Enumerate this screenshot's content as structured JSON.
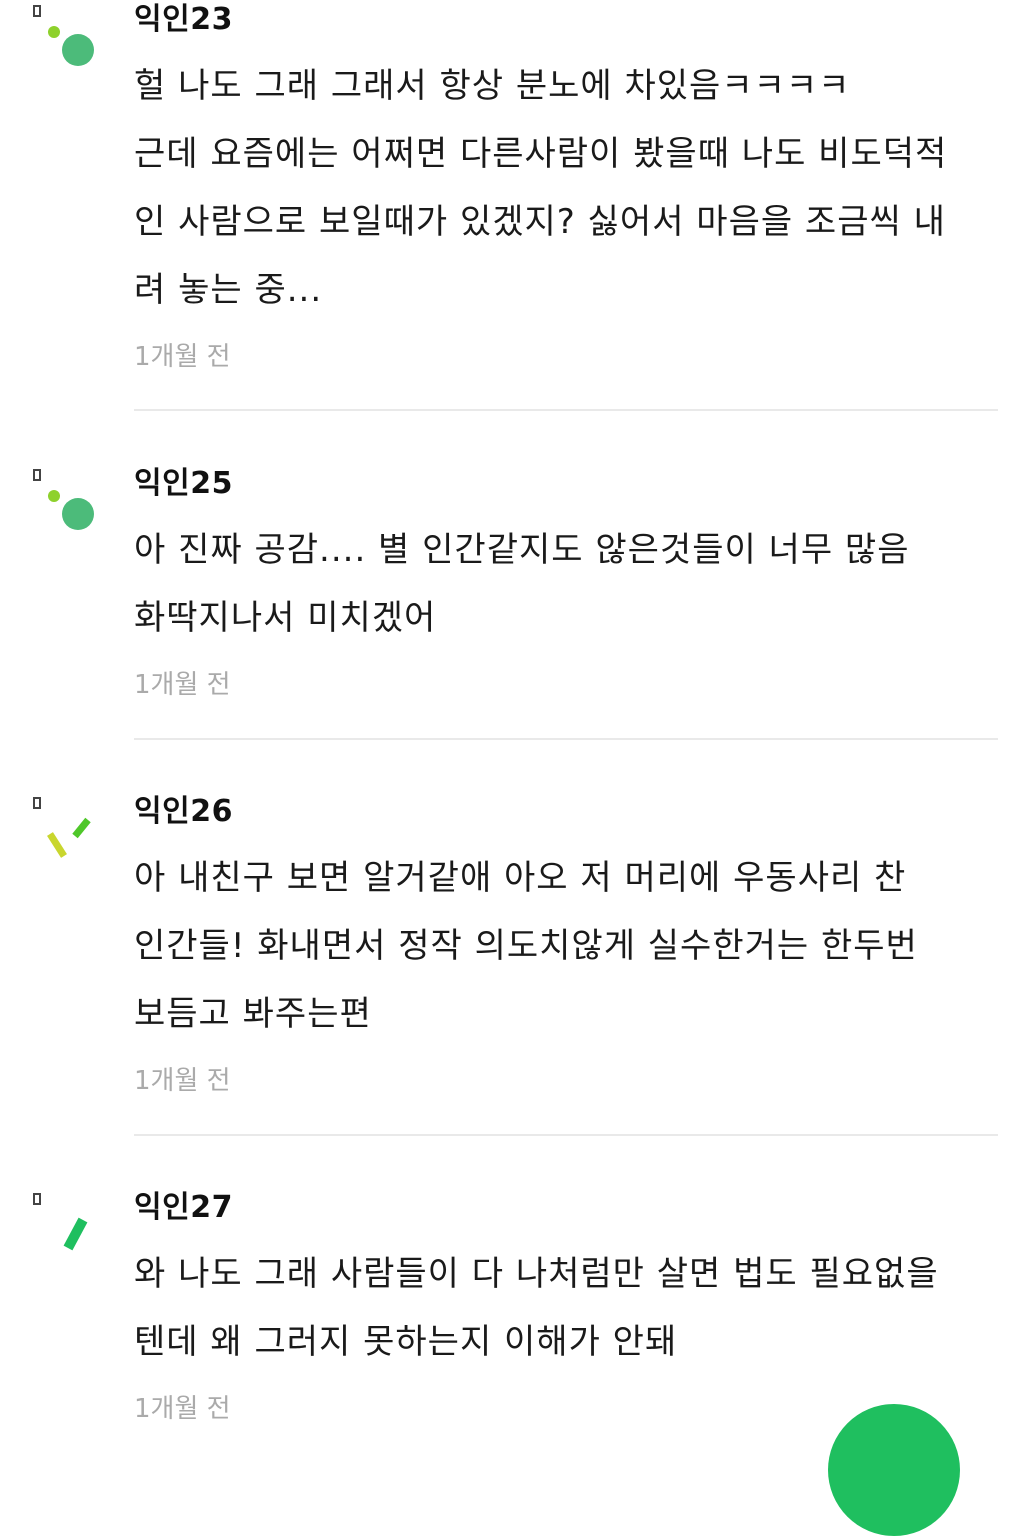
{
  "comments": [
    {
      "author": "익인23",
      "lines": [
        "헐 나도 그래 그래서 항상 분노에 차있음ㅋㅋㅋㅋ",
        "근데 요즘에는 어쩌면 다른사람이 봤을때 나도 비도덕적",
        "인 사람으로 보일때가 있겠지? 싫어서 마음을 조금씩 내",
        "려 놓는 중..."
      ],
      "time": "1개월 전",
      "avatar_icon": "dots-avatar-icon"
    },
    {
      "author": "익인25",
      "lines": [
        "아 진짜 공감.... 별 인간같지도 않은것들이 너무 많음",
        "화딱지나서 미치겠어"
      ],
      "time": "1개월 전",
      "avatar_icon": "dots-avatar-icon"
    },
    {
      "author": "익인26",
      "lines": [
        "아 내친구 보면 알거같애 아오 저 머리에 우동사리 찬",
        "인간들! 화내면서 정작 의도치않게 실수한거는 한두번",
        "보듬고 봐주는편"
      ],
      "time": "1개월 전",
      "avatar_icon": "slash-avatar-icon"
    },
    {
      "author": "익인27",
      "lines": [
        "와 나도 그래 사람들이 다 나처럼만 살면 법도 필요없을",
        "텐데 왜 그러지 못하는지 이해가 안돼"
      ],
      "time": "1개월 전",
      "avatar_icon": "bar-avatar-icon"
    }
  ],
  "colors": {
    "accent_green": "#1fbf5f",
    "avatar_green": "#4cbb7a",
    "avatar_lime": "#8ed12c",
    "avatar_yellow": "#c9d62e",
    "time_gray": "#aaaaaa",
    "divider": "#e9e9e9"
  },
  "fab_icon": "write-fab-icon"
}
